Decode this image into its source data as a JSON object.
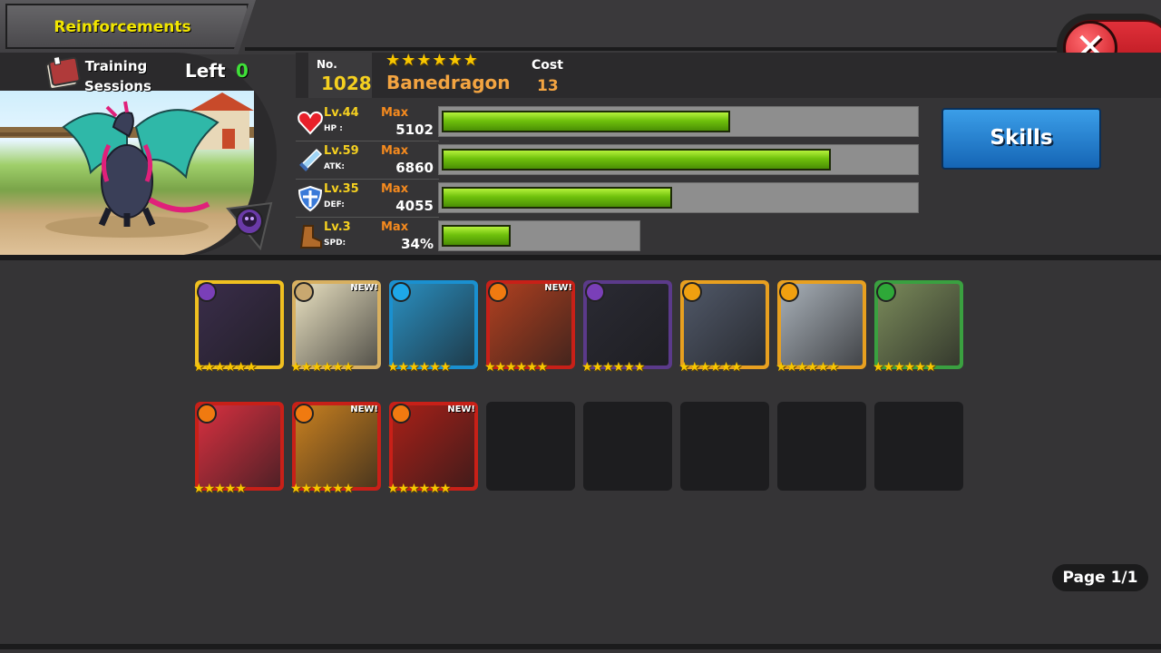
{
  "header": {
    "title": "Reinforcements",
    "close_label": "✕"
  },
  "training": {
    "label_line1": "Training",
    "label_line2": "Sessions",
    "left_label": "Left",
    "left_value": "0"
  },
  "unit": {
    "no_label": "No.",
    "no_value": "1028",
    "stars": "★★★★★★",
    "name": "Banedragon",
    "cost_label": "Cost",
    "cost_value": "13"
  },
  "stats": [
    {
      "icon": "heart-icon",
      "level": "Lv.44",
      "name": "HP :",
      "max": "Max",
      "value": "5102",
      "fill": 0.6,
      "track_fraction": 1.0
    },
    {
      "icon": "sword-icon",
      "level": "Lv.59",
      "name": "ATK:",
      "max": "Max",
      "value": "6860",
      "fill": 0.81,
      "track_fraction": 1.0
    },
    {
      "icon": "shield-icon",
      "level": "Lv.35",
      "name": "DEF:",
      "max": "Max",
      "value": "4055",
      "fill": 0.48,
      "track_fraction": 1.0
    },
    {
      "icon": "boot-icon",
      "level": "Lv.3",
      "name": "SPD:",
      "max": "Max",
      "value": "34%",
      "fill": 0.34,
      "track_fraction": 0.42
    }
  ],
  "skills_label": "Skills",
  "cards_row1": [
    {
      "element": "dark",
      "elem_color": "#7a3fb8",
      "frame": "#f0c020",
      "art": "#3a2d4a",
      "new": "",
      "stars": "★★★★★★"
    },
    {
      "element": "light",
      "elem_color": "#c8a870",
      "frame": "#d8b060",
      "art": "#e8e0c0",
      "new": "NEW!",
      "stars": "★★★★★★"
    },
    {
      "element": "water",
      "elem_color": "#1ea7e8",
      "frame": "#1a90d0",
      "art": "#2a8fc0",
      "new": "",
      "stars": "★★★★★★"
    },
    {
      "element": "fire",
      "elem_color": "#f07a10",
      "frame": "#c82018",
      "art": "#b04020",
      "new": "NEW!",
      "stars": "★★★★★★"
    },
    {
      "element": "dark",
      "elem_color": "#7a3fb8",
      "frame": "#5b3a8a",
      "art": "#2a2a33",
      "new": "",
      "stars": "★★★★★★"
    },
    {
      "element": "thunder",
      "elem_color": "#f0a010",
      "frame": "#e8a020",
      "art": "#505868",
      "new": "",
      "stars": "★★★★★★"
    },
    {
      "element": "thunder",
      "elem_color": "#f0a010",
      "frame": "#e8a020",
      "art": "#a8b0b8",
      "new": "",
      "stars": "★★★★★★"
    },
    {
      "element": "earth",
      "elem_color": "#2ea838",
      "frame": "#3aa040",
      "art": "#7a8a5a",
      "new": "",
      "stars": "★★★★★★"
    }
  ],
  "cards_row2": [
    {
      "element": "fire",
      "elem_color": "#f07a10",
      "frame": "#c82018",
      "art": "#d83040",
      "new": "",
      "stars": "★★★★★"
    },
    {
      "element": "fire",
      "elem_color": "#f07a10",
      "frame": "#c82018",
      "art": "#c88020",
      "new": "NEW!",
      "stars": "★★★★★★"
    },
    {
      "element": "fire",
      "elem_color": "#f07a10",
      "frame": "#c82018",
      "art": "#a82018",
      "new": "NEW!",
      "stars": "★★★★★★"
    }
  ],
  "empty_slots": 5,
  "page_label": "Page 1/1"
}
